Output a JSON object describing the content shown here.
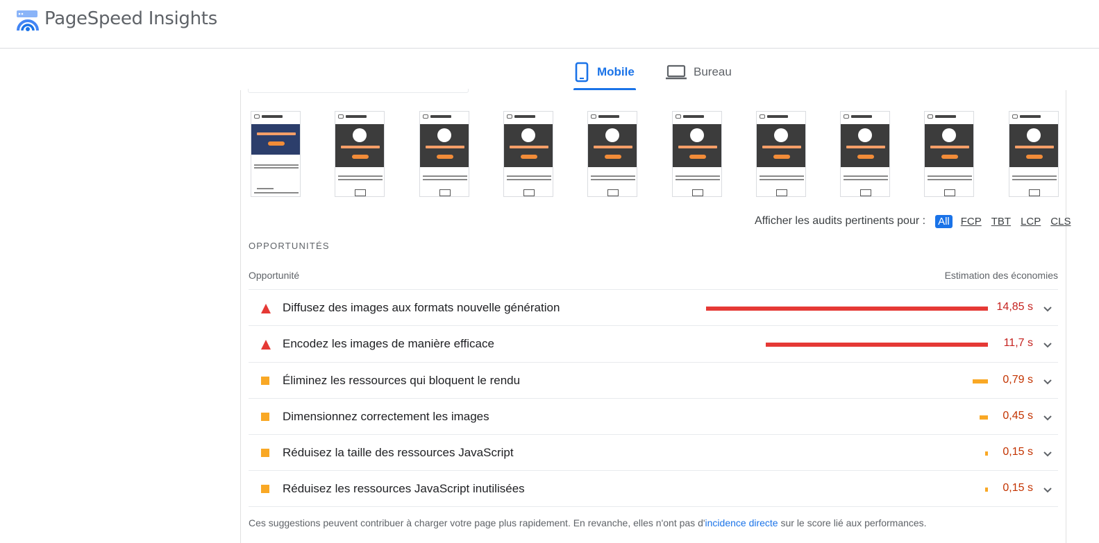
{
  "header": {
    "app_title": "PageSpeed Insights",
    "logo_icon": "pagespeed-gauge-icon"
  },
  "device_tabs": [
    {
      "label": "Mobile",
      "icon": "phone-icon",
      "active": true
    },
    {
      "label": "Bureau",
      "icon": "laptop-icon",
      "active": false
    }
  ],
  "filter": {
    "label": "Afficher les audits pertinents pour :",
    "options": [
      "All",
      "FCP",
      "TBT",
      "LCP",
      "CLS"
    ],
    "selected": "All"
  },
  "opportunities": {
    "section_title": "OPPORTUNITÉS",
    "col_left": "Opportunité",
    "col_right": "Estimation des économies",
    "items": [
      {
        "title": "Diffusez des images aux formats nouvelle génération",
        "saving": "14,85 s",
        "severity": "fail",
        "fraction": 1.0
      },
      {
        "title": "Encodez les images de manière efficace",
        "saving": "11,7 s",
        "severity": "fail",
        "fraction": 0.788
      },
      {
        "title": "Éliminez les ressources qui bloquent le rendu",
        "saving": "0,79 s",
        "severity": "average",
        "fraction": 0.053
      },
      {
        "title": "Dimensionnez correctement les images",
        "saving": "0,45 s",
        "severity": "average",
        "fraction": 0.03
      },
      {
        "title": "Réduisez la taille des ressources JavaScript",
        "saving": "0,15 s",
        "severity": "average",
        "fraction": 0.01
      },
      {
        "title": "Réduisez les ressources JavaScript inutilisées",
        "saving": "0,15 s",
        "severity": "average",
        "fraction": 0.01
      }
    ],
    "footnote": {
      "before": "Ces suggestions peuvent contribuer à charger votre page plus rapidement. En revanche, elles n'ont pas d'",
      "link": "incidence directe",
      "after": " sur le score lié aux performances."
    }
  },
  "colors": {
    "fail": "#e53935",
    "fail_text": "#c5221f",
    "average": "#f9a825",
    "average_text": "#c33300",
    "accent": "#1a73e8"
  }
}
